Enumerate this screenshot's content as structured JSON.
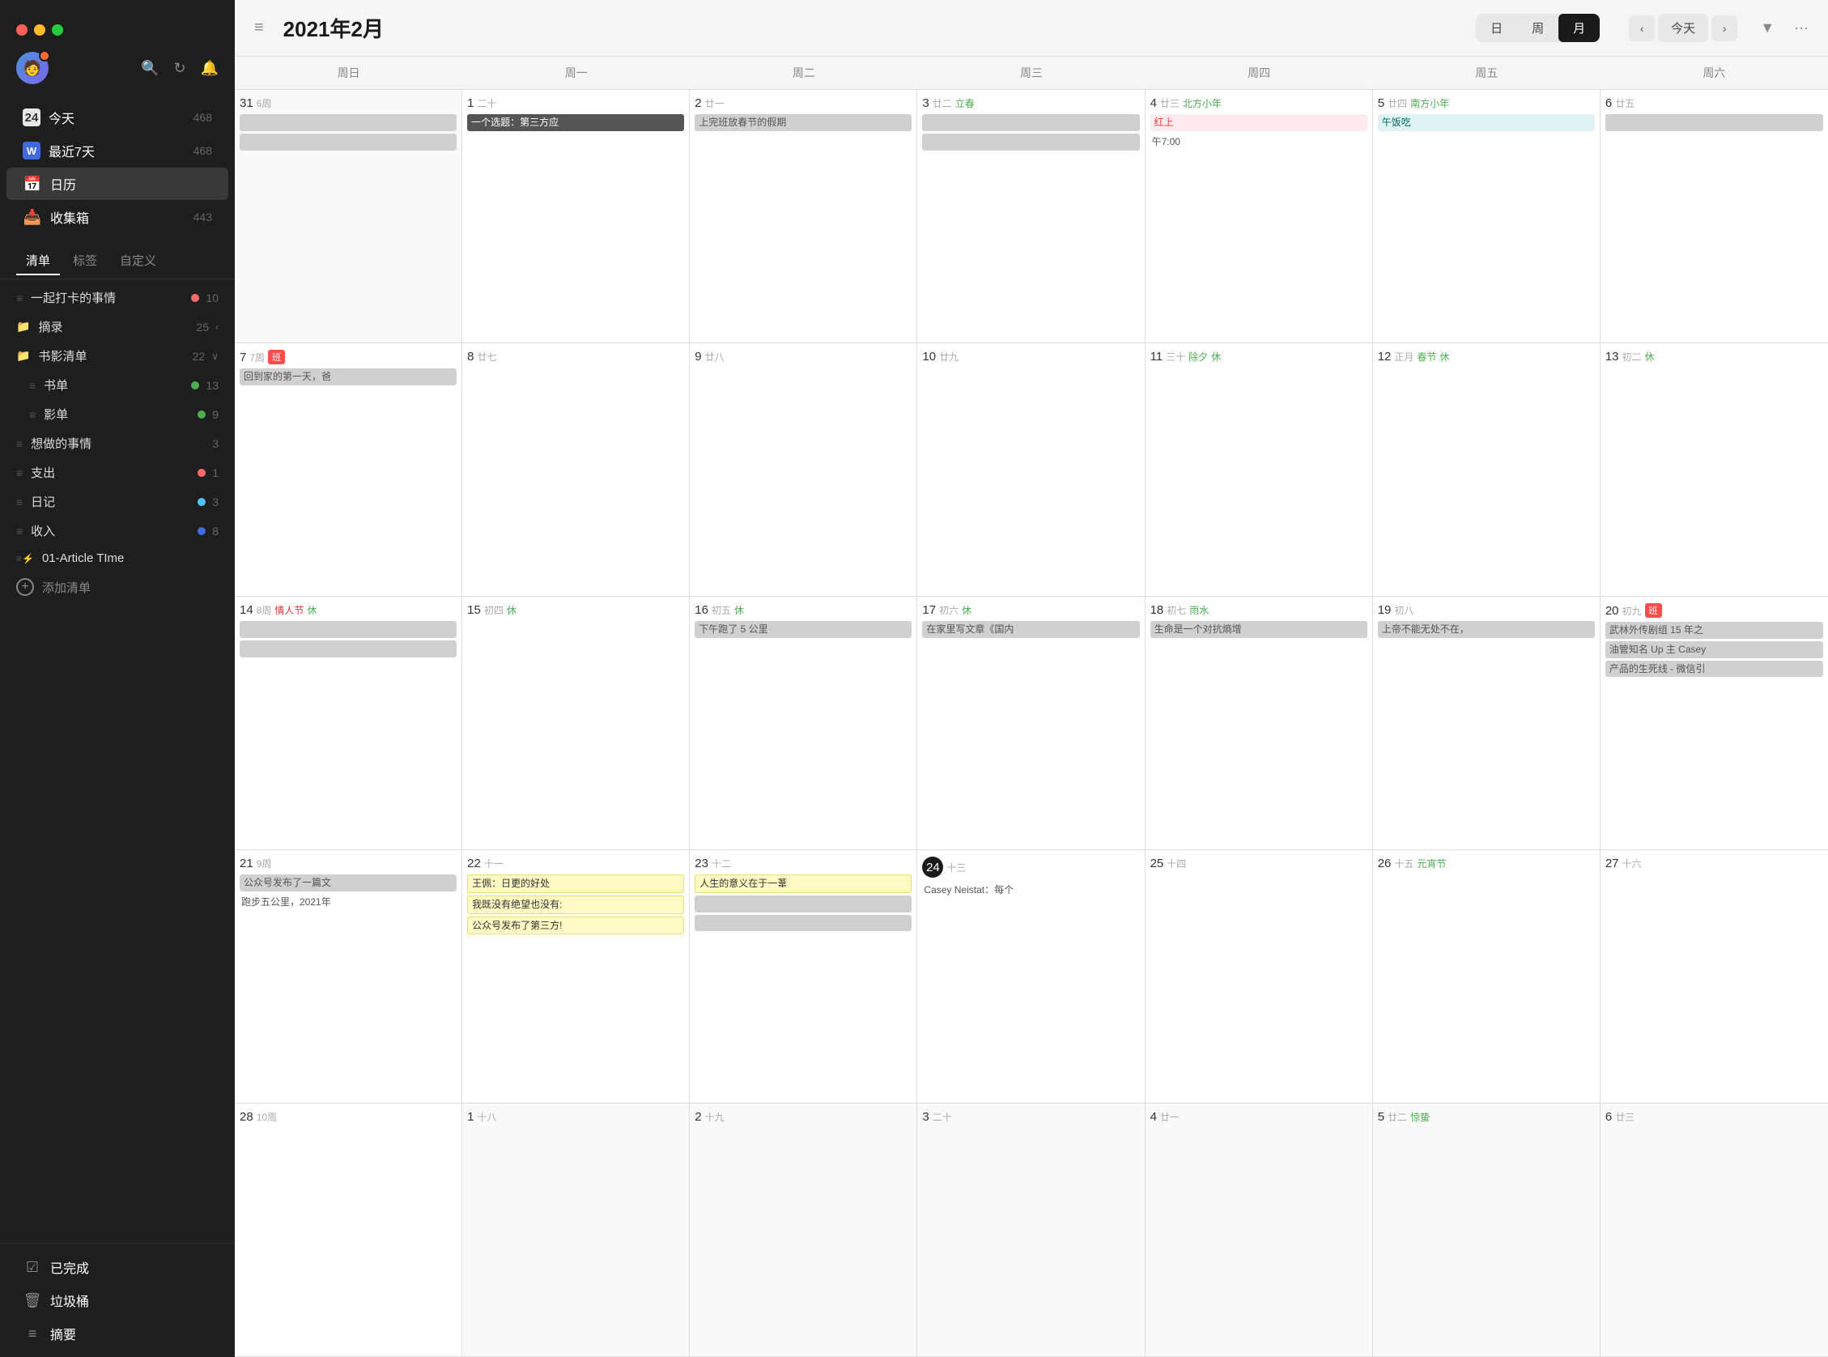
{
  "app": {
    "title": "2021年2月",
    "windowControls": [
      "红",
      "黄",
      "绿"
    ]
  },
  "sidebar": {
    "navItems": [
      {
        "id": "today",
        "icon": "📅",
        "label": "今天",
        "count": "468",
        "iconText": "24"
      },
      {
        "id": "recent7",
        "icon": "📝",
        "label": "最近7天",
        "count": "468",
        "iconText": "W"
      },
      {
        "id": "calendar",
        "icon": "📆",
        "label": "日历",
        "count": "",
        "active": true
      },
      {
        "id": "inbox",
        "icon": "📥",
        "label": "收集箱",
        "count": "443"
      }
    ],
    "tabs": [
      "清单",
      "标签",
      "自定义"
    ],
    "activeTab": "清单",
    "lists": [
      {
        "id": "checkin",
        "icon": "≡",
        "label": "一起打卡的事情",
        "dotColor": "#ff6b6b",
        "count": "10",
        "arrow": ""
      },
      {
        "id": "excerpt",
        "icon": "📁",
        "label": "摘录",
        "count": "25",
        "arrow": "‹"
      },
      {
        "id": "media",
        "icon": "📁",
        "label": "书影清单",
        "count": "22",
        "arrow": "∨"
      },
      {
        "id": "books",
        "icon": "≡",
        "label": "书单",
        "dotColor": "#4CAF50",
        "count": "13",
        "indent": true
      },
      {
        "id": "movies",
        "icon": "≡",
        "label": "影单",
        "dotColor": "#4CAF50",
        "count": "9",
        "indent": true
      },
      {
        "id": "todo",
        "icon": "≡",
        "label": "想做的事情",
        "count": "3"
      },
      {
        "id": "expense",
        "icon": "≡",
        "label": "支出",
        "dotColor": "#ff6b6b",
        "count": "1"
      },
      {
        "id": "diary",
        "icon": "≡",
        "label": "日记",
        "dotColor": "#4fc3f7",
        "count": "3"
      },
      {
        "id": "income",
        "icon": "≡",
        "label": "收入",
        "dotColor": "#4169e1",
        "count": "8"
      },
      {
        "id": "article",
        "icon": "≡",
        "label": "01-Article TIme",
        "count": ""
      }
    ],
    "addList": "添加清单",
    "footer": [
      {
        "id": "completed",
        "icon": "☑",
        "label": "已完成"
      },
      {
        "id": "trash",
        "icon": "🗑",
        "label": "垃圾桶"
      },
      {
        "id": "summary",
        "icon": "≡",
        "label": "摘要"
      }
    ]
  },
  "calendar": {
    "viewButtons": [
      "日",
      "周",
      "月"
    ],
    "activeView": "月",
    "navPrev": "‹",
    "navNext": "›",
    "todayBtn": "今天",
    "weekdays": [
      "周日",
      "周一",
      "周二",
      "周三",
      "周四",
      "周五",
      "周六"
    ],
    "weeks": [
      {
        "days": [
          {
            "date": "31",
            "lunar": "6周",
            "otherMonth": true,
            "events": [
              {
                "text": "",
                "type": "gray"
              },
              {
                "text": "",
                "type": "gray"
              }
            ]
          },
          {
            "date": "1",
            "lunar": "二十",
            "events": [
              {
                "text": "一个选题：第三方应",
                "type": "dark"
              }
            ]
          },
          {
            "date": "2",
            "lunar": "廿一",
            "events": [
              {
                "text": "上完班放春节的假期",
                "type": "gray"
              }
            ]
          },
          {
            "date": "3",
            "lunar": "廿二 立春",
            "festival": "立春",
            "events": [
              {
                "text": "",
                "type": "gray"
              },
              {
                "text": "",
                "type": "gray"
              }
            ]
          },
          {
            "date": "4",
            "lunar": "廿三",
            "festival": "北方小年",
            "festivalColor": "green",
            "events": [
              {
                "text": "红上",
                "type": "red-inline"
              },
              {
                "text": "午7:00",
                "type": "plain"
              }
            ]
          },
          {
            "date": "5",
            "lunar": "廿四",
            "festival": "南方小年",
            "festivalColor": "green",
            "events": [
              {
                "text": "午饭吃",
                "type": "teal"
              }
            ]
          },
          {
            "date": "6",
            "lunar": "廿五",
            "otherMonth": false,
            "events": [
              {
                "text": "",
                "type": "gray"
              }
            ]
          }
        ]
      },
      {
        "days": [
          {
            "date": "7",
            "lunar": "7周",
            "badge": "班",
            "badgeColor": "red",
            "events": [
              {
                "text": "回到家的第一天，爸",
                "type": "gray"
              }
            ]
          },
          {
            "date": "8",
            "lunar": "廿七",
            "events": []
          },
          {
            "date": "9",
            "lunar": "廿八",
            "events": []
          },
          {
            "date": "10",
            "lunar": "廿九",
            "events": []
          },
          {
            "date": "11",
            "lunar": "三十 除夕",
            "festival": "除夕",
            "holiday": "休",
            "events": []
          },
          {
            "date": "12",
            "lunar": "正月 春节",
            "festival": "春节",
            "festivalColor": "green",
            "holiday": "休",
            "events": []
          },
          {
            "date": "13",
            "lunar": "初二",
            "holiday": "休",
            "events": []
          }
        ]
      },
      {
        "days": [
          {
            "date": "14",
            "lunar": "8周 情人节",
            "festival": "情人节",
            "festivalColor": "red",
            "holiday": "休",
            "events": [
              {
                "text": "",
                "type": "gray"
              },
              {
                "text": "",
                "type": "gray"
              }
            ]
          },
          {
            "date": "15",
            "lunar": "初四",
            "holiday": "休",
            "events": []
          },
          {
            "date": "16",
            "lunar": "初五",
            "holiday": "休",
            "events": [
              {
                "text": "下午跑了 5 公里",
                "type": "gray"
              }
            ]
          },
          {
            "date": "17",
            "lunar": "初六",
            "holiday": "休",
            "events": [
              {
                "text": "在家里写文章《国内",
                "type": "gray"
              }
            ]
          },
          {
            "date": "18",
            "lunar": "初七 雨水",
            "festival": "雨水",
            "events": [
              {
                "text": "生命是一个对抗熵增",
                "type": "gray"
              }
            ]
          },
          {
            "date": "19",
            "lunar": "初八",
            "events": [
              {
                "text": "上帝不能无处不在，",
                "type": "gray"
              }
            ]
          },
          {
            "date": "20",
            "lunar": "初九",
            "badge": "班",
            "badgeColor": "red",
            "events": [
              {
                "text": "武林外传剧组 15 年之",
                "type": "gray"
              },
              {
                "text": "油管知名 Up 主 Casey",
                "type": "gray"
              },
              {
                "text": "产品的生死线 - 微信引",
                "type": "gray"
              }
            ]
          }
        ]
      },
      {
        "days": [
          {
            "date": "21",
            "lunar": "9周",
            "events": [
              {
                "text": "公众号发布了一篇文",
                "type": "gray"
              },
              {
                "text": "跑步五公里，2021年",
                "type": "plain"
              }
            ]
          },
          {
            "date": "22",
            "lunar": "十一",
            "events": [
              {
                "text": "王佩：日更的好处",
                "type": "yellow"
              },
              {
                "text": "我既没有绝望也没有:",
                "type": "yellow"
              },
              {
                "text": "公众号发布了第三方!",
                "type": "yellow"
              }
            ]
          },
          {
            "date": "23",
            "lunar": "十二",
            "events": [
              {
                "text": "人生的意义在于一葦",
                "type": "yellow"
              },
              {
                "text": "",
                "type": "gray"
              },
              {
                "text": "",
                "type": "gray"
              }
            ]
          },
          {
            "date": "24",
            "lunar": "十三",
            "isToday": true,
            "events": [
              {
                "text": "Casey Neistat：每个",
                "type": "plain"
              }
            ]
          },
          {
            "date": "25",
            "lunar": "十四",
            "events": []
          },
          {
            "date": "26",
            "lunar": "十五 元宵节",
            "festival": "元宵节",
            "festivalColor": "green",
            "events": []
          },
          {
            "date": "27",
            "lunar": "十六",
            "events": []
          }
        ]
      },
      {
        "days": [
          {
            "date": "28",
            "lunar": "10周",
            "events": []
          },
          {
            "date": "1",
            "lunar": "十八",
            "otherMonth": true,
            "events": []
          },
          {
            "date": "2",
            "lunar": "十九",
            "otherMonth": true,
            "events": []
          },
          {
            "date": "3",
            "lunar": "二十",
            "otherMonth": true,
            "events": []
          },
          {
            "date": "4",
            "lunar": "廿一",
            "otherMonth": true,
            "events": []
          },
          {
            "date": "5",
            "lunar": "廿二 惊蛰",
            "festival": "惊蛰",
            "otherMonth": true,
            "events": []
          },
          {
            "date": "6",
            "lunar": "廿三",
            "otherMonth": true,
            "events": []
          }
        ]
      }
    ]
  }
}
